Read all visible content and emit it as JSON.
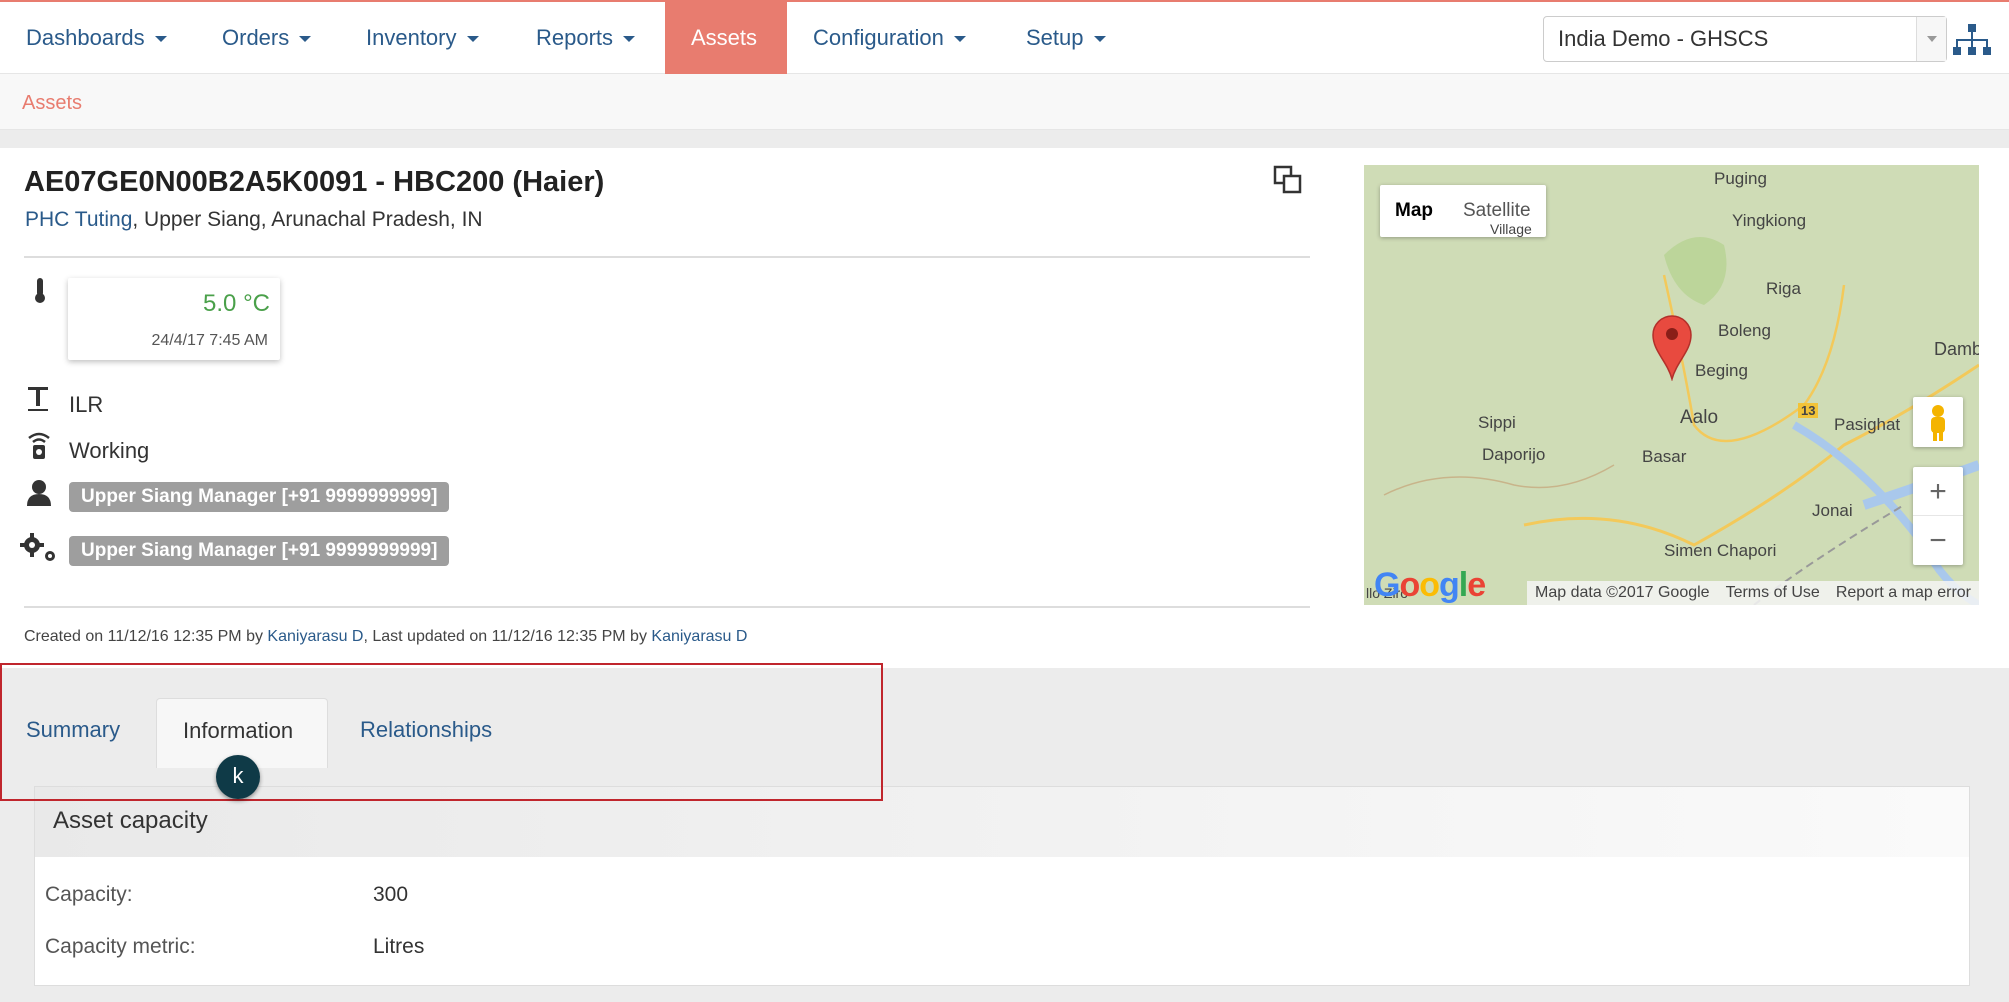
{
  "nav": {
    "items": [
      {
        "label": "Dashboards",
        "dropdown": true
      },
      {
        "label": "Orders",
        "dropdown": true
      },
      {
        "label": "Inventory",
        "dropdown": true
      },
      {
        "label": "Reports",
        "dropdown": true
      },
      {
        "label": "Assets",
        "dropdown": false,
        "active": true
      },
      {
        "label": "Configuration",
        "dropdown": true
      },
      {
        "label": "Setup",
        "dropdown": true
      }
    ],
    "domain": "India Demo - GHSCS",
    "accent_color": "#e87c6f"
  },
  "breadcrumb": "Assets",
  "asset": {
    "title": "AE07GE0N00B2A5K0091 - HBC200 (Haier)",
    "location_link": "PHC Tuting",
    "location_rest": ", Upper Siang, Arunachal Pradesh, IN",
    "temperature": "5.0 °C",
    "temperature_time": "24/4/17 7:45 AM",
    "type": "ILR",
    "status": "Working",
    "owner": "Upper Siang Manager [+91 9999999999]",
    "maintainer": "Upper Siang Manager [+91 9999999999]",
    "meta": {
      "created_prefix": "Created on 11/12/16 12:35 PM by ",
      "created_by": "Kaniyarasu D",
      "updated_prefix": ", Last updated on 11/12/16 12:35 PM by ",
      "updated_by": "Kaniyarasu D"
    }
  },
  "map": {
    "type_map": "Map",
    "type_satellite": "Satellite",
    "labels": [
      "Puging",
      "Yingkiong",
      "Village",
      "Riga",
      "Boleng",
      "Dambu",
      "Beging",
      "13",
      "Sippi",
      "Aalo",
      "Pasighat",
      "Daporijo",
      "Basar",
      "Jonai",
      "Simen Chapori",
      "llo Ziro"
    ],
    "attribution": "Map data ©2017 Google",
    "terms": "Terms of Use",
    "report": "Report a map error",
    "google": "Google",
    "zoom_in": "+",
    "zoom_out": "−"
  },
  "tabs": [
    "Summary",
    "Information",
    "Relationships"
  ],
  "cursor_label": "k",
  "capacity": {
    "title": "Asset capacity",
    "rows": [
      {
        "label": "Capacity:",
        "value": "300"
      },
      {
        "label": "Capacity metric:",
        "value": "Litres"
      }
    ]
  }
}
